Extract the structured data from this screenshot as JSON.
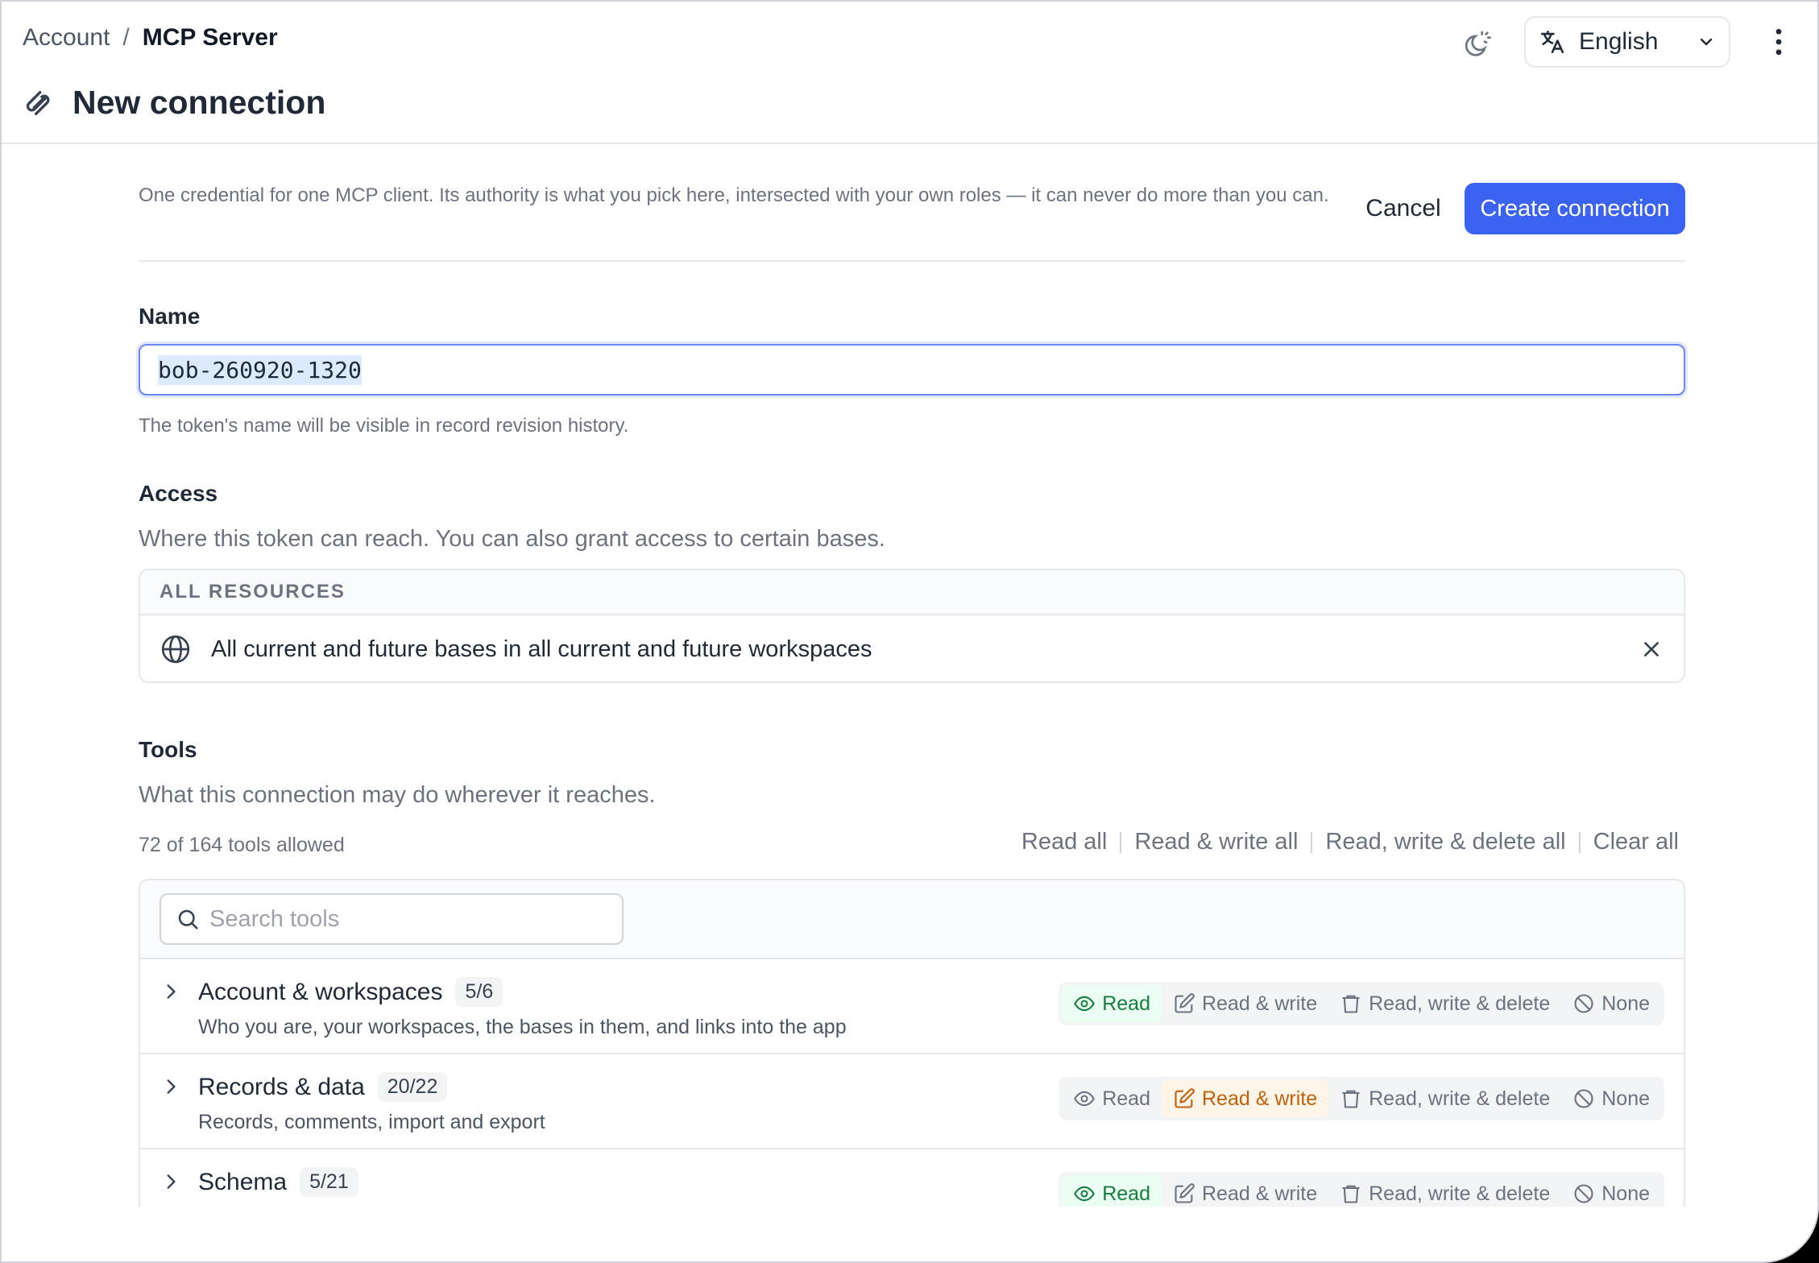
{
  "breadcrumb": {
    "parent": "Account",
    "separator": "/",
    "current": "MCP Server"
  },
  "page": {
    "title": "New connection"
  },
  "header": {
    "language": "English"
  },
  "intro": {
    "text": "One credential for one MCP client. Its authority is what you pick here, intersected with your own roles — it can never do more than you can.",
    "cancel_label": "Cancel",
    "create_label": "Create connection"
  },
  "name": {
    "label": "Name",
    "value": "bob-260920-1320",
    "help": "The token's name will be visible in record revision history."
  },
  "access": {
    "label": "Access",
    "help": "Where this token can reach. You can also grant access to certain bases.",
    "resource_header": "ALL RESOURCES",
    "resource_text": "All current and future bases in all current and future workspaces"
  },
  "tools": {
    "label": "Tools",
    "help": "What this connection may do wherever it reaches.",
    "count": "72 of 164 tools allowed",
    "bulk": {
      "read_all": "Read all",
      "read_write_all": "Read & write all",
      "read_write_delete_all": "Read, write & delete all",
      "clear_all": "Clear all"
    },
    "search_placeholder": "Search tools",
    "permission_labels": {
      "read": "Read",
      "read_write": "Read & write",
      "read_write_delete": "Read, write & delete",
      "none": "None"
    },
    "groups": [
      {
        "name": "Account & workspaces",
        "badge": "5/6",
        "description": "Who you are, your workspaces, the bases in them, and links into the app",
        "selected": "read"
      },
      {
        "name": "Records & data",
        "badge": "20/22",
        "description": "Records, comments, import and export",
        "selected": "read_write"
      },
      {
        "name": "Schema",
        "badge": "5/21",
        "description": "",
        "selected": "read"
      }
    ]
  },
  "colors": {
    "primary": "#3b63f3",
    "read_active_bg": "#ecfdf3",
    "read_active_text": "#15803d",
    "rw_active_bg": "#fff4e8",
    "rw_active_text": "#c2610c"
  }
}
